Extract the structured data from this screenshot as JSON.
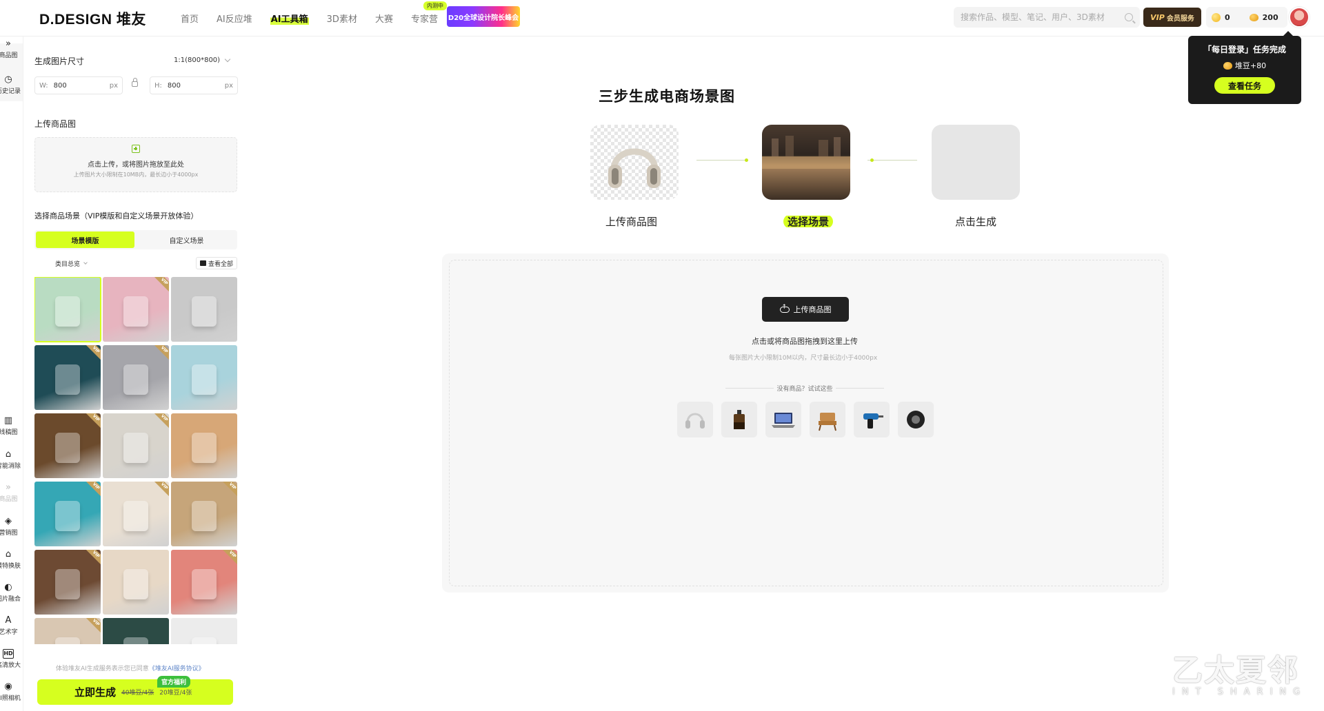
{
  "header": {
    "logo": "D.DESIGN 堆友",
    "nav": [
      {
        "label": "首页",
        "active": false
      },
      {
        "label": "AI反应堆",
        "active": false
      },
      {
        "label": "AI工具箱",
        "active": true
      },
      {
        "label": "3D素材",
        "active": false
      },
      {
        "label": "大赛",
        "active": false
      },
      {
        "label": "专家营",
        "active": false,
        "badge": "内测中"
      }
    ],
    "banner": "D20全球设计院长峰会",
    "search_placeholder": "搜索作品、模型、笔记、用户、3D素材",
    "vip_mark": "VIP",
    "vip_label": "会员服务",
    "coins": "0",
    "beans": "200"
  },
  "popover": {
    "title": "「每日登录」任务完成",
    "reward": "堆豆+80",
    "button": "查看任务"
  },
  "rail": [
    {
      "label": "商品图",
      "icon": "double-chevron-icon"
    },
    {
      "label": "历史记录",
      "icon": "history-icon"
    },
    {
      "label": "线稿图",
      "icon": "book-icon"
    },
    {
      "label": "智能消除",
      "icon": "eraser-icon"
    },
    {
      "label": "商品图",
      "icon": "chevron-icon"
    },
    {
      "label": "营销图",
      "icon": "layers-icon"
    },
    {
      "label": "模特换肤",
      "icon": "shirt-icon"
    },
    {
      "label": "图片融合",
      "icon": "blend-icon"
    },
    {
      "label": "艺术字",
      "icon": "letter-a-icon"
    },
    {
      "label": "高清放大",
      "icon": "hd-icon"
    },
    {
      "label": "AI照相机",
      "icon": "camera-icon"
    }
  ],
  "panel": {
    "size_label": "生成图片尺寸",
    "ratio": "1:1(800*800)",
    "width_prefix": "W:",
    "width_value": "800",
    "height_prefix": "H:",
    "height_value": "800",
    "unit": "px",
    "upload_label": "上传商品图",
    "upload_hint": "点击上传，或将图片拖放至此处",
    "upload_limit": "上传图片大小限制在10MB内，最长边小于4000px",
    "scene_label": "选择商品场景（VIP模版和自定义场景开放体验）",
    "tabs": [
      {
        "label": "场景模版",
        "active": true
      },
      {
        "label": "自定义场景",
        "active": false
      }
    ],
    "category": "类目总览",
    "view_all": "查看全部",
    "thumbnails": [
      {
        "name": "coffee-machine",
        "bg": "#b9dcc2",
        "vip": false,
        "selected": true
      },
      {
        "name": "headphones-pink",
        "bg": "#e7b4bf",
        "vip": true
      },
      {
        "name": "washing-machine",
        "bg": "#c9c9c9",
        "vip": false
      },
      {
        "name": "laptop-aurora",
        "bg": "#1f4c56",
        "vip": true
      },
      {
        "name": "phones",
        "bg": "#a5a5aa",
        "vip": true
      },
      {
        "name": "cosmetic-tube",
        "bg": "#a9d3dc",
        "vip": false
      },
      {
        "name": "perfume-bottle",
        "bg": "#6b4a2c",
        "vip": true
      },
      {
        "name": "flower-vase",
        "bg": "#d8d4cc",
        "vip": true
      },
      {
        "name": "snack-bag",
        "bg": "#d7a777",
        "vip": false
      },
      {
        "name": "drink-can",
        "bg": "#35a7b5",
        "vip": true
      },
      {
        "name": "teddy-bear",
        "bg": "#e9dfd2",
        "vip": true
      },
      {
        "name": "food-package",
        "bg": "#c6a57a",
        "vip": true
      },
      {
        "name": "green-chair",
        "bg": "#6d4a33",
        "vip": true
      },
      {
        "name": "tissue-box",
        "bg": "#e7d8c6",
        "vip": false
      },
      {
        "name": "perfume-red",
        "bg": "#e2857b",
        "vip": true
      },
      {
        "name": "bedroom",
        "bg": "#d9c7b2",
        "vip": true
      },
      {
        "name": "dark-cap",
        "bg": "#2c4b45",
        "vip": false
      },
      {
        "name": "washer-white",
        "bg": "#ececec",
        "vip": false
      }
    ],
    "agreement_prefix": "体验堆友AI生成服务表示您已同意",
    "agreement_link": "《堆友AI服务协议》",
    "generate_label": "立即生成",
    "price_old": "40堆豆/4张",
    "price_new": "20堆豆/4张",
    "generate_badge": "官方福利"
  },
  "main": {
    "title": "三步生成电商场景图",
    "steps": [
      {
        "label": "上传商品图",
        "active": false
      },
      {
        "label": "选择场景",
        "active": true
      },
      {
        "label": "点击生成",
        "active": false
      }
    ],
    "upload_button": "上传商品图",
    "hint": "点击或将商品图拖拽到这里上传",
    "limit": "每张图片大小限制10M以内，尺寸最长边小于4000px",
    "try_label": "没有商品？试试这些",
    "samples": [
      "headphones",
      "perfume",
      "laptop",
      "chair",
      "drill",
      "tire"
    ]
  },
  "watermark": {
    "title": "乙太夏邻",
    "sub": "INT SHARING"
  }
}
